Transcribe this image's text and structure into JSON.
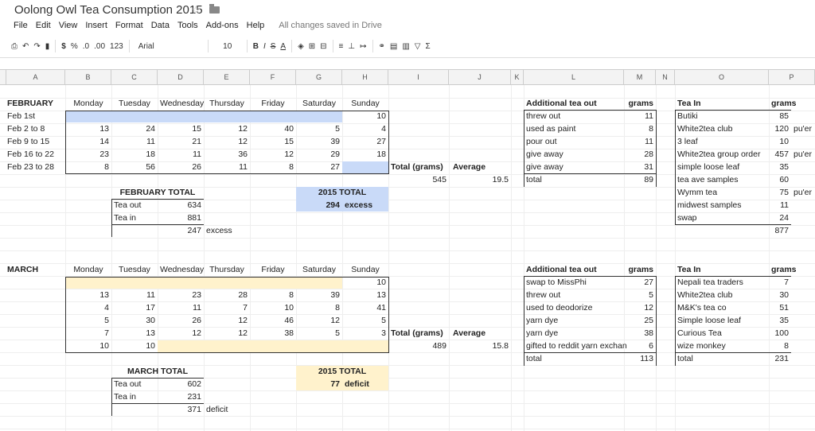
{
  "header": {
    "title": "Oolong Owl Tea Consumption 2015",
    "star_icon": "star-icon",
    "folder_icon": "folder-icon"
  },
  "menu": [
    "File",
    "Edit",
    "View",
    "Insert",
    "Format",
    "Data",
    "Tools",
    "Add-ons",
    "Help"
  ],
  "save_status": "All changes saved in Drive",
  "toolbar": {
    "currency": "$",
    "percent": "%",
    "dec_less": ".0",
    "dec_more": ".00",
    "format_more": "123",
    "font": "Arial",
    "size": "10",
    "bold": "B",
    "italic": "I",
    "strike": "S",
    "textcolor": "A",
    "sigma": "Σ"
  },
  "columns": [
    "A",
    "B",
    "C",
    "D",
    "E",
    "F",
    "G",
    "H",
    "I",
    "J",
    "K",
    "L",
    "M",
    "N",
    "O",
    "P"
  ],
  "february": {
    "label": "FEBRUARY",
    "days": [
      "Monday",
      "Tuesday",
      "Wednesday",
      "Thursday",
      "Friday",
      "Saturday",
      "Sunday"
    ],
    "rows": [
      {
        "label": "Feb 1st",
        "values": [
          "",
          "",
          "",
          "",
          "",
          "",
          "10"
        ]
      },
      {
        "label": "Feb 2 to 8",
        "values": [
          "13",
          "24",
          "15",
          "12",
          "40",
          "5",
          "4"
        ]
      },
      {
        "label": "Feb 9 to 15",
        "values": [
          "14",
          "11",
          "21",
          "12",
          "15",
          "39",
          "27"
        ]
      },
      {
        "label": "Feb 16 to 22",
        "values": [
          "23",
          "18",
          "11",
          "36",
          "12",
          "29",
          "18"
        ]
      },
      {
        "label": "Feb 23 to 28",
        "values": [
          "8",
          "56",
          "26",
          "11",
          "8",
          "27",
          ""
        ]
      }
    ],
    "total_grams_label": "Total (grams)",
    "average_label": "Average",
    "total_grams": "545",
    "average": "19.5",
    "total_label": "FEBRUARY TOTAL",
    "tea_out_label": "Tea out",
    "tea_out": "634",
    "tea_in_label": "Tea in",
    "tea_in": "881",
    "net": "247",
    "net_label": "excess",
    "ytd_label": "2015 TOTAL",
    "ytd": "294",
    "ytd_status": "excess",
    "additional": {
      "header": "Additional tea out",
      "grams": "grams",
      "items": [
        {
          "name": "threw out",
          "g": "11"
        },
        {
          "name": "used as paint",
          "g": "8"
        },
        {
          "name": "pour out",
          "g": "11"
        },
        {
          "name": "give away",
          "g": "28"
        },
        {
          "name": "give away",
          "g": "31"
        },
        {
          "name": "total",
          "g": "89"
        }
      ]
    },
    "tea_in_list": {
      "header": "Tea In",
      "grams": "grams",
      "items": [
        {
          "name": "Butiki",
          "g": "85",
          "note": ""
        },
        {
          "name": "White2tea club",
          "g": "120",
          "note": "pu'er"
        },
        {
          "name": "3 leaf",
          "g": "10",
          "note": ""
        },
        {
          "name": "White2tea group order",
          "g": "457",
          "note": "pu'er"
        },
        {
          "name": "simple loose leaf",
          "g": "35",
          "note": ""
        },
        {
          "name": "tea ave samples",
          "g": "60",
          "note": ""
        },
        {
          "name": "Wymm tea",
          "g": "75",
          "note": "pu'er"
        },
        {
          "name": "midwest samples",
          "g": "11",
          "note": ""
        },
        {
          "name": "swap",
          "g": "24",
          "note": ""
        }
      ],
      "total": "877"
    }
  },
  "march": {
    "label": "MARCH",
    "days": [
      "Monday",
      "Tuesday",
      "Wednesday",
      "Thursday",
      "Friday",
      "Saturday",
      "Sunday"
    ],
    "rows": [
      {
        "values": [
          "",
          "",
          "",
          "",
          "",
          "",
          "10"
        ]
      },
      {
        "values": [
          "13",
          "11",
          "23",
          "28",
          "8",
          "39",
          "13"
        ]
      },
      {
        "values": [
          "4",
          "17",
          "11",
          "7",
          "10",
          "8",
          "41"
        ]
      },
      {
        "values": [
          "5",
          "30",
          "26",
          "12",
          "46",
          "12",
          "5"
        ]
      },
      {
        "values": [
          "7",
          "13",
          "12",
          "12",
          "38",
          "5",
          "3"
        ]
      },
      {
        "values": [
          "10",
          "10",
          "",
          "",
          "",
          "",
          ""
        ]
      }
    ],
    "total_grams_label": "Total (grams)",
    "average_label": "Average",
    "total_grams": "489",
    "average": "15.8",
    "total_label": "MARCH TOTAL",
    "tea_out_label": "Tea out",
    "tea_out": "602",
    "tea_in_label": "Tea in",
    "tea_in": "231",
    "net": "371",
    "net_label": "deficit",
    "ytd_label": "2015 TOTAL",
    "ytd": "77",
    "ytd_status": "deficit",
    "additional": {
      "header": "Additional tea out",
      "grams": "grams",
      "items": [
        {
          "name": "swap to MissPhi",
          "g": "27"
        },
        {
          "name": "threw out",
          "g": "5"
        },
        {
          "name": "used to deodorize",
          "g": "12"
        },
        {
          "name": "yarn dye",
          "g": "25"
        },
        {
          "name": "yarn dye",
          "g": "38"
        },
        {
          "name": "gifted to reddit yarn exchan",
          "g": "6"
        },
        {
          "name": "total",
          "g": "113"
        }
      ]
    },
    "tea_in_list": {
      "header": "Tea In",
      "grams": "grams",
      "items": [
        {
          "name": "Nepali tea traders",
          "g": "7"
        },
        {
          "name": "White2tea club",
          "g": "30"
        },
        {
          "name": "M&K's tea co",
          "g": "51"
        },
        {
          "name": "Simple loose leaf",
          "g": "35"
        },
        {
          "name": "Curious Tea",
          "g": "100"
        },
        {
          "name": "wize monkey",
          "g": "8"
        },
        {
          "name": "total",
          "g": "231"
        }
      ]
    }
  }
}
